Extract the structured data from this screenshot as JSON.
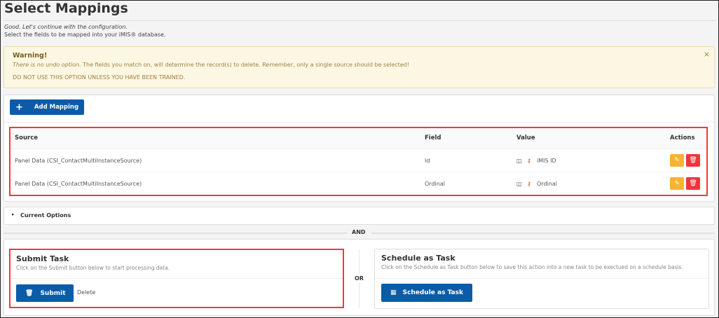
{
  "page": {
    "title": "Select Mappings",
    "intro_italic": "Good. Let's continue with the configuration.",
    "intro_text": "Select the fields to be mapped into your iMIS® database."
  },
  "warning": {
    "title": "Warning!",
    "line1_italic": "There is no undo option.",
    "line1_rest": " The fields you match on, will determine the record(s) to delete. Remember, only a single source should be selected!",
    "line2": "DO NOT USE THIS OPTION UNLESS YOU HAVE BEEN TRAINED.",
    "close": "×"
  },
  "mappings": {
    "add_label": "Add Mapping",
    "headers": {
      "source": "Source",
      "field": "Field",
      "value": "Value",
      "actions": "Actions"
    },
    "rows": [
      {
        "source": "Panel Data (CSI_ContactMultiInstanceSource)",
        "field": "Id",
        "value": "iMIS ID"
      },
      {
        "source": "Panel Data (CSI_ContactMultiInstanceSource)",
        "field": "Ordinal",
        "value": "Ordinal"
      }
    ]
  },
  "options": {
    "label": "Current Options"
  },
  "divider": {
    "and": "AND",
    "or": "OR"
  },
  "submit": {
    "title": "Submit Task",
    "desc": "Click on the Submit button below to start processing data.",
    "button": "Submit",
    "delete": "Delete"
  },
  "schedule": {
    "title": "Schedule as Task",
    "desc": "Click on the Schedule as Task button below to save this action into a new task to be exectued on a schedule basis.",
    "button": "Schedule as Task"
  }
}
